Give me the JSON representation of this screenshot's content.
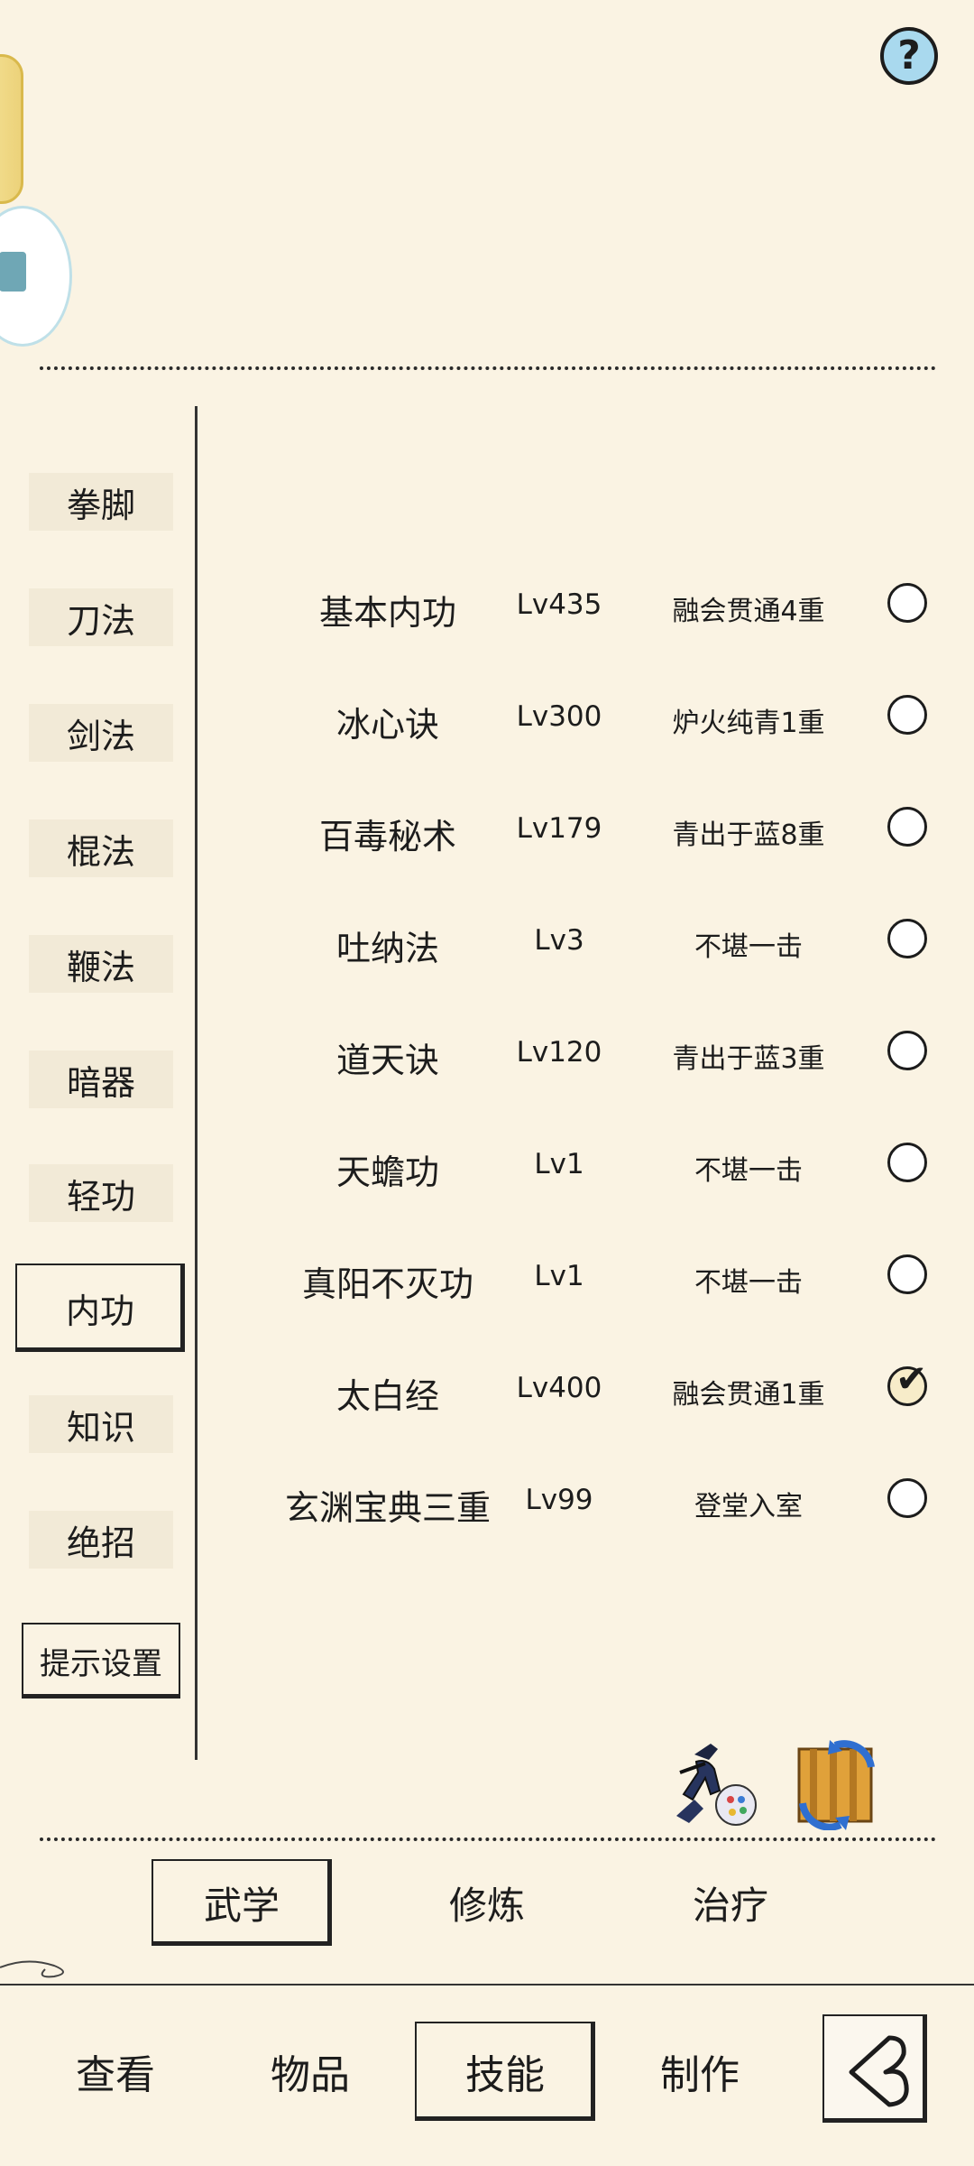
{
  "help": {
    "icon": "question-mark-icon",
    "label": "?"
  },
  "sidebar": {
    "categories": [
      {
        "label": "拳脚"
      },
      {
        "label": "刀法"
      },
      {
        "label": "剑法"
      },
      {
        "label": "棍法"
      },
      {
        "label": "鞭法"
      },
      {
        "label": "暗器"
      },
      {
        "label": "轻功"
      },
      {
        "label": "内功",
        "active": true
      },
      {
        "label": "知识"
      },
      {
        "label": "绝招"
      }
    ],
    "hint_settings": "提示设置"
  },
  "skills": [
    {
      "name": "基本内功",
      "level": "Lv435",
      "rank": "融会贯通4重",
      "selected": false
    },
    {
      "name": "冰心诀",
      "level": "Lv300",
      "rank": "炉火纯青1重",
      "selected": false
    },
    {
      "name": "百毒秘术",
      "level": "Lv179",
      "rank": "青出于蓝8重",
      "selected": false
    },
    {
      "name": "吐纳法",
      "level": "Lv3",
      "rank": "不堪一击",
      "selected": false
    },
    {
      "name": "道天诀",
      "level": "Lv120",
      "rank": "青出于蓝3重",
      "selected": false
    },
    {
      "name": "天蟾功",
      "level": "Lv1",
      "rank": "不堪一击",
      "selected": false
    },
    {
      "name": "真阳不灭功",
      "level": "Lv1",
      "rank": "不堪一击",
      "selected": false
    },
    {
      "name": "太白经",
      "level": "Lv400",
      "rank": "融会贯通1重",
      "selected": true
    },
    {
      "name": "玄渊宝典三重",
      "level": "Lv99",
      "rank": "登堂入室",
      "selected": false
    }
  ],
  "check_mark": "✔",
  "sub_tabs": [
    {
      "label": "武学",
      "active": true
    },
    {
      "label": "修炼"
    },
    {
      "label": "治疗"
    }
  ],
  "bottom_nav": [
    {
      "label": "查看"
    },
    {
      "label": "物品"
    },
    {
      "label": "技能",
      "active": true
    },
    {
      "label": "制作"
    }
  ],
  "icons": {
    "ninja": "ninja-paint-icon",
    "scroll": "scroll-swap-icon",
    "back": "back-arrow-icon"
  }
}
